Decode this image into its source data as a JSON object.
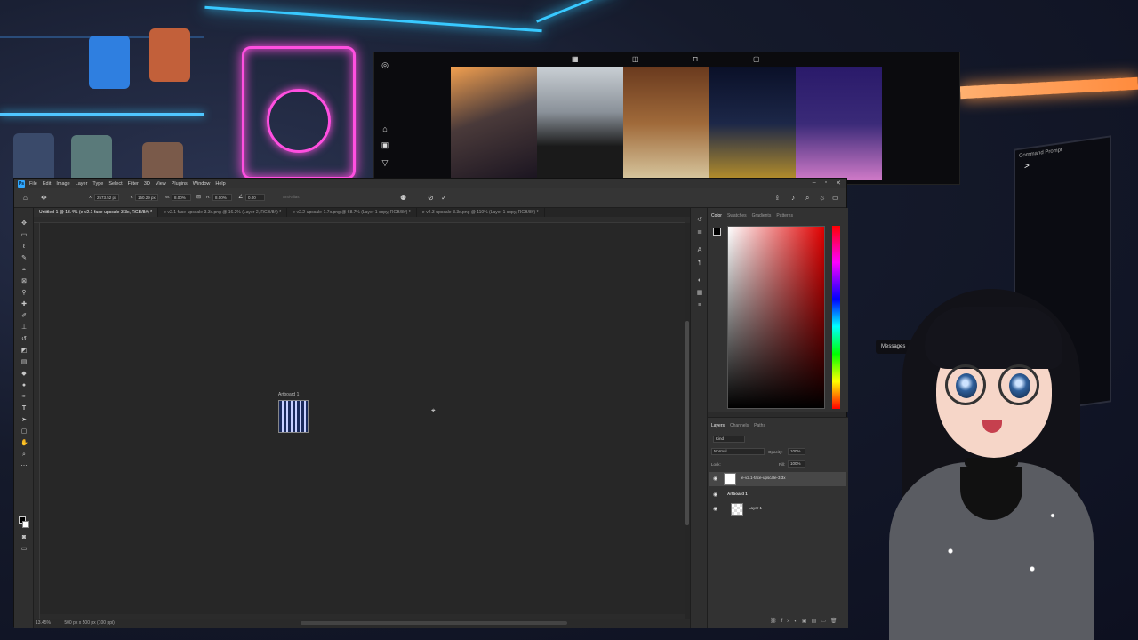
{
  "background": {
    "terminal_title": "Command Prompt",
    "terminal_cursor": ">",
    "messages_label": "Messages"
  },
  "insta": {
    "thumb_colors": [
      "#4a3a3a",
      "#8a9199",
      "#a06a3a",
      "#1c2748",
      "#3a2a78"
    ]
  },
  "photoshop": {
    "menu": [
      "File",
      "Edit",
      "Image",
      "Layer",
      "Type",
      "Select",
      "Filter",
      "3D",
      "View",
      "Plugins",
      "Window",
      "Help"
    ],
    "options": {
      "x_label": "X:",
      "x_value": "2573.52 px",
      "y_label": "Y:",
      "y_value": "150.29 px",
      "w_label": "W:",
      "w_value": "8.00%",
      "h_label": "H:",
      "h_value": "8.00%",
      "angle_value": "0.00",
      "antialias_label": "Anti-alias"
    },
    "doc_tabs": [
      "Untitled-1 @ 13.4% (e-v2.1-face-upscale-3.3x, RGB/8#) *",
      "e-v2.1-face-upscale-3.3x.png @ 16.2% (Layer 2, RGB/8#) *",
      "e-v2.2-upscale-1.7x.png @ 68.7% (Layer 1 copy, RGB/8#) *",
      "e-v2.3-upscale-3.3x.png @ 110% (Layer 1 copy, RGB/8#) *"
    ],
    "canvas": {
      "artboard_label": "Artboard 1"
    },
    "status": {
      "zoom": "13.45%",
      "doc_size": "500 px x 500 px (100 ppi)"
    },
    "color_panel": {
      "tabs": [
        "Color",
        "Swatches",
        "Gradients",
        "Patterns"
      ]
    },
    "layers_panel": {
      "tabs": [
        "Layers",
        "Channels",
        "Paths"
      ],
      "kind_filter": "Kind",
      "blend_mode": "Normal",
      "opacity_label": "Opacity:",
      "opacity_value": "100%",
      "lock_label": "Lock:",
      "fill_label": "Fill:",
      "fill_value": "100%",
      "layers": [
        {
          "name": "e-v2.1-face-upscale-3.3x",
          "selected": true
        },
        {
          "name": "Artboard 1",
          "selected": false
        },
        {
          "name": "Layer 1",
          "selected": false
        }
      ]
    }
  }
}
